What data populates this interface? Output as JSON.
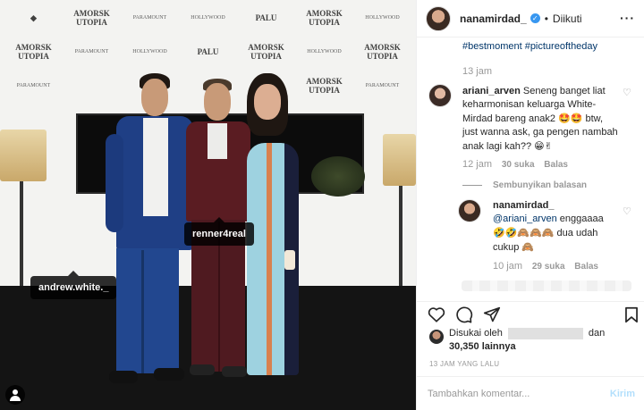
{
  "post": {
    "photo_alt": "Event photo with three people posing in front of a branded backdrop",
    "backdrop_logos": [
      "AMORSK UTOPIA",
      "PALU",
      "HOLLYWOOD",
      "PARAMOUNT",
      "AMORSK UTOPIA",
      "PALU",
      "HOLLYWOOD"
    ],
    "tags": {
      "andrew": "andrew.white._",
      "renner": "renner4real"
    }
  },
  "header": {
    "username": "nanamirdad_",
    "verified_icon": "verified-badge-icon",
    "separator": "•",
    "follow_status": "Diikuti",
    "more_icon": "more-options-icon"
  },
  "comments": {
    "hashtags": "#bestmoment #pictureoftheday",
    "caption_time": "13 jam",
    "c1": {
      "username": "ariani_arven",
      "text": "Seneng banget liat keharmonisan keluarga White-Mirdad bareng anak2",
      "emoji_a": "🤩🤩",
      "text2": "btw, just wanna ask, ga pengen nambah anak lagi kah??",
      "emoji_b": "😁✌",
      "time": "12 jam",
      "likes": "30 suka",
      "reply": "Balas"
    },
    "hide_replies": "Sembunyikan balasan",
    "r1": {
      "username": "nanamirdad_",
      "mention": "@ariani_arven",
      "text": "enggaaaa",
      "emojis": "🤣🤣🙈🙈🙈",
      "text2": "dua udah cukup",
      "emoji_end": "🙈",
      "time": "10 jam",
      "likes": "29 suka",
      "reply": "Balas"
    }
  },
  "likes": {
    "prefix": "Disukai oleh",
    "connector": "dan",
    "count": "30,350 lainnya"
  },
  "post_time": "13 JAM YANG LALU",
  "comment_box": {
    "placeholder": "Tambahkan komentar...",
    "send": "Kirim"
  },
  "colors": {
    "link": "#003569",
    "muted": "#999999",
    "verified": "#3897f0",
    "send_disabled": "#b2dffc"
  }
}
